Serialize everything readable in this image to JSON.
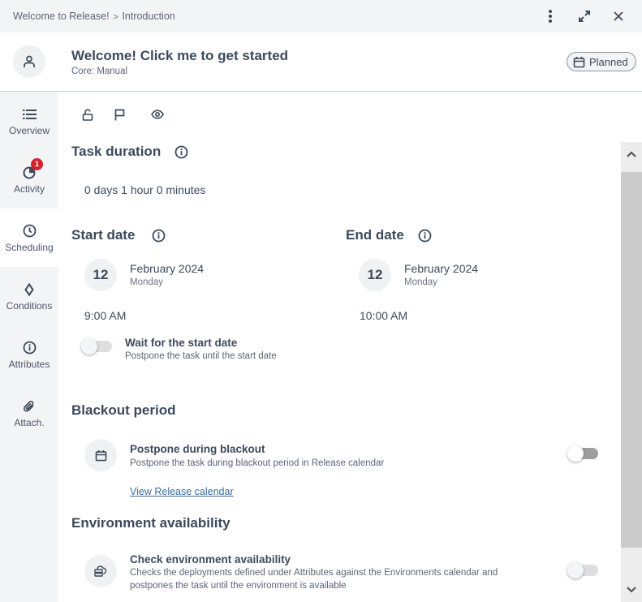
{
  "topbar": {
    "breadcrumb": [
      "Welcome to Release!",
      "Introduction"
    ],
    "breadcrumb_separator": ">",
    "icons": [
      "more-vertical-icon",
      "expand-icon",
      "close-icon"
    ]
  },
  "header": {
    "task_title": "Welcome! Click me to get started",
    "task_subtitle": "Core: Manual",
    "avatar_icon": "user-icon",
    "status": {
      "label": "Planned",
      "icon": "calendar-icon"
    }
  },
  "sidebar": {
    "items": [
      {
        "label": "Overview",
        "icon": "list-icon",
        "active": false
      },
      {
        "label": "Activity",
        "icon": "activity-icon",
        "active": false,
        "badge": "1"
      },
      {
        "label": "Scheduling",
        "icon": "clock-icon",
        "active": true
      },
      {
        "label": "Conditions",
        "icon": "diamond-icon",
        "active": false
      },
      {
        "label": "Attributes",
        "icon": "info-icon",
        "active": false
      },
      {
        "label": "Attach.",
        "icon": "paperclip-icon",
        "active": false
      }
    ]
  },
  "toolbar_icons": [
    "unlock-icon",
    "flag-icon",
    "eye-icon"
  ],
  "scheduling": {
    "task_duration": {
      "title": "Task duration",
      "value": "0 days 1 hour 0 minutes"
    },
    "start_date": {
      "title": "Start date",
      "day": "12",
      "month_year": "February 2024",
      "weekday": "Monday",
      "time": "9:00 AM"
    },
    "end_date": {
      "title": "End date",
      "day": "12",
      "month_year": "February 2024",
      "weekday": "Monday",
      "time": "10:00 AM"
    },
    "wait_for_start": {
      "title": "Wait for the start date",
      "description": "Postpone the task until the start date",
      "enabled": false
    },
    "blackout": {
      "section_title": "Blackout period",
      "title": "Postpone during blackout",
      "description": "Postpone the task during blackout period in Release calendar",
      "link": "View Release calendar",
      "enabled": false
    },
    "environment": {
      "section_title": "Environment availability",
      "title": "Check environment availability",
      "description_line1": "Checks the deployments defined under Attributes against the Environments calendar and",
      "description_line2": "postpones the task until the environment is available",
      "enabled": false
    }
  },
  "colors": {
    "text_primary": "#3d4a5c",
    "badge_red": "#d3222a",
    "link_blue": "#3b6c9a",
    "sidebar_bg": "#f3f4f6"
  }
}
